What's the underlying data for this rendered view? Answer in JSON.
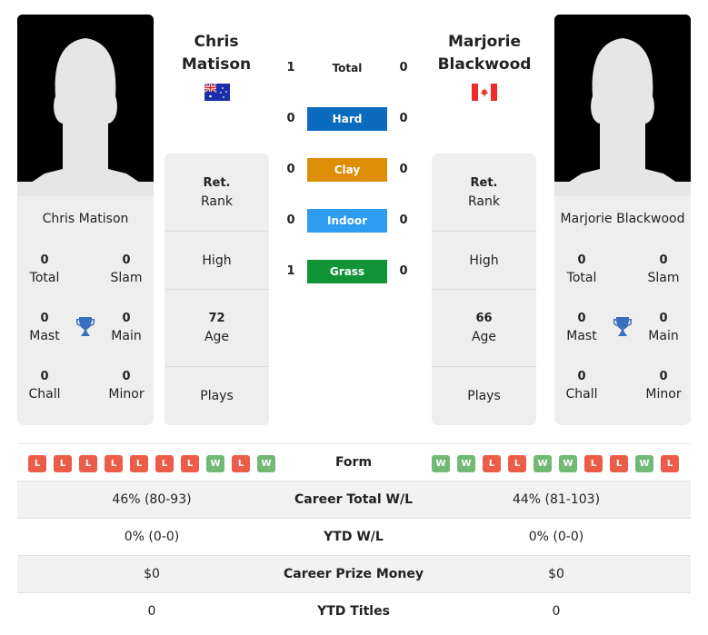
{
  "player1": {
    "name_line1": "Chris",
    "name_line2": "Matison",
    "full_name": "Chris Matison",
    "flag": "australia-flag",
    "titles": {
      "total": {
        "value": "0",
        "label": "Total"
      },
      "slam": {
        "value": "0",
        "label": "Slam"
      },
      "mast": {
        "value": "0",
        "label": "Mast"
      },
      "main": {
        "value": "0",
        "label": "Main"
      },
      "chall": {
        "value": "0",
        "label": "Chall"
      },
      "minor": {
        "value": "0",
        "label": "Minor"
      }
    },
    "info": {
      "rank_value": "Ret.",
      "rank_label": "Rank",
      "high_label": "High",
      "age_value": "72",
      "age_label": "Age",
      "plays_label": "Plays"
    },
    "form": [
      "L",
      "L",
      "L",
      "L",
      "L",
      "L",
      "L",
      "W",
      "L",
      "W"
    ]
  },
  "player2": {
    "name_line1": "Marjorie",
    "name_line2": "Blackwood",
    "full_name": "Marjorie Blackwood",
    "flag": "canada-flag",
    "titles": {
      "total": {
        "value": "0",
        "label": "Total"
      },
      "slam": {
        "value": "0",
        "label": "Slam"
      },
      "mast": {
        "value": "0",
        "label": "Mast"
      },
      "main": {
        "value": "0",
        "label": "Main"
      },
      "chall": {
        "value": "0",
        "label": "Chall"
      },
      "minor": {
        "value": "0",
        "label": "Minor"
      }
    },
    "info": {
      "rank_value": "Ret.",
      "rank_label": "Rank",
      "high_label": "High",
      "age_value": "66",
      "age_label": "Age",
      "plays_label": "Plays"
    },
    "form": [
      "W",
      "W",
      "L",
      "L",
      "W",
      "W",
      "L",
      "L",
      "W",
      "L"
    ]
  },
  "h2h": [
    {
      "label": "Total",
      "p1": "1",
      "p2": "0",
      "color": ""
    },
    {
      "label": "Hard",
      "p1": "0",
      "p2": "0",
      "color": "#0a6bbf"
    },
    {
      "label": "Clay",
      "p1": "0",
      "p2": "0",
      "color": "#de8e06"
    },
    {
      "label": "Indoor",
      "p1": "0",
      "p2": "0",
      "color": "#2d9cf1"
    },
    {
      "label": "Grass",
      "p1": "1",
      "p2": "0",
      "color": "#119438"
    }
  ],
  "form_label": "Form",
  "comparison": [
    {
      "label": "Career Total W/L",
      "p1": "46% (80-93)",
      "p2": "44% (81-103)"
    },
    {
      "label": "YTD W/L",
      "p1": "0% (0-0)",
      "p2": "0% (0-0)"
    },
    {
      "label": "Career Prize Money",
      "p1": "$0",
      "p2": "$0"
    },
    {
      "label": "YTD Titles",
      "p1": "0",
      "p2": "0"
    }
  ],
  "colors": {
    "loss": "#ec5d49",
    "win": "#72b976",
    "trophy": "#3a6fbf"
  }
}
